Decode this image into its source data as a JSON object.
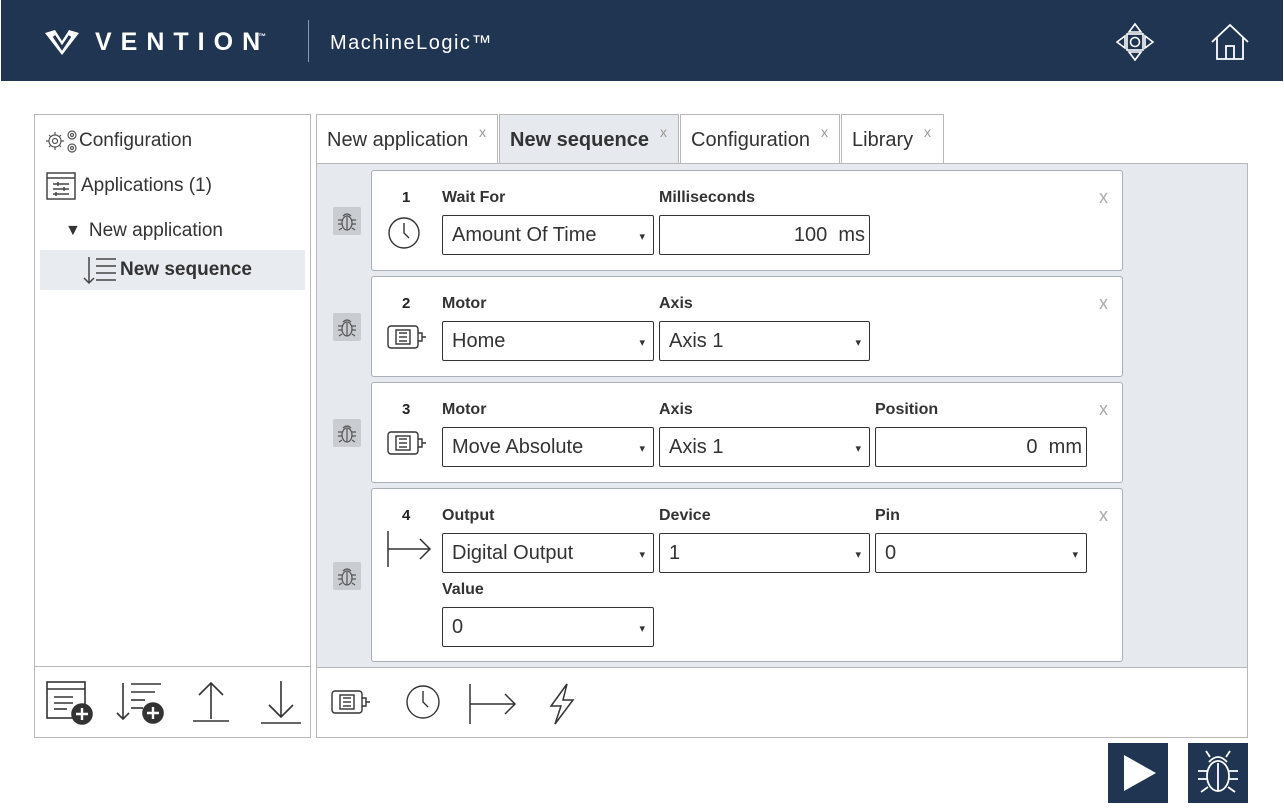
{
  "header": {
    "brand": "VENTION",
    "brand_tm": "™",
    "app_title": "MachineLogic™",
    "bg_color": "#1f3552"
  },
  "tree": {
    "configuration": "Configuration",
    "applications": "Applications (1)",
    "application_name": "New application",
    "application_toggle": "▼",
    "sequence_name": "New sequence"
  },
  "tabs": [
    {
      "label": "New application",
      "close": "x"
    },
    {
      "label": "New sequence",
      "close": "x"
    },
    {
      "label": "Configuration",
      "close": "x"
    },
    {
      "label": "Library",
      "close": "x"
    }
  ],
  "steps": [
    {
      "num": "1",
      "label_a": "Wait For",
      "value_a": "Amount Of Time",
      "label_b": "Milliseconds",
      "value_b": "100",
      "unit_b": "ms",
      "close": "x"
    },
    {
      "num": "2",
      "label_a": "Motor",
      "value_a": "Home",
      "label_b": "Axis",
      "value_b": "Axis 1",
      "close": "x"
    },
    {
      "num": "3",
      "label_a": "Motor",
      "value_a": "Move Absolute",
      "label_b": "Axis",
      "value_b": "Axis 1",
      "label_c": "Position",
      "value_c": "0",
      "unit_c": "mm",
      "close": "x"
    },
    {
      "num": "4",
      "label_a": "Output",
      "value_a": "Digital Output",
      "label_b": "Device",
      "value_b": "1",
      "label_c": "Pin",
      "value_c": "0",
      "label_d": "Value",
      "value_d": "0",
      "close": "x"
    }
  ],
  "select_arrow": "▾"
}
